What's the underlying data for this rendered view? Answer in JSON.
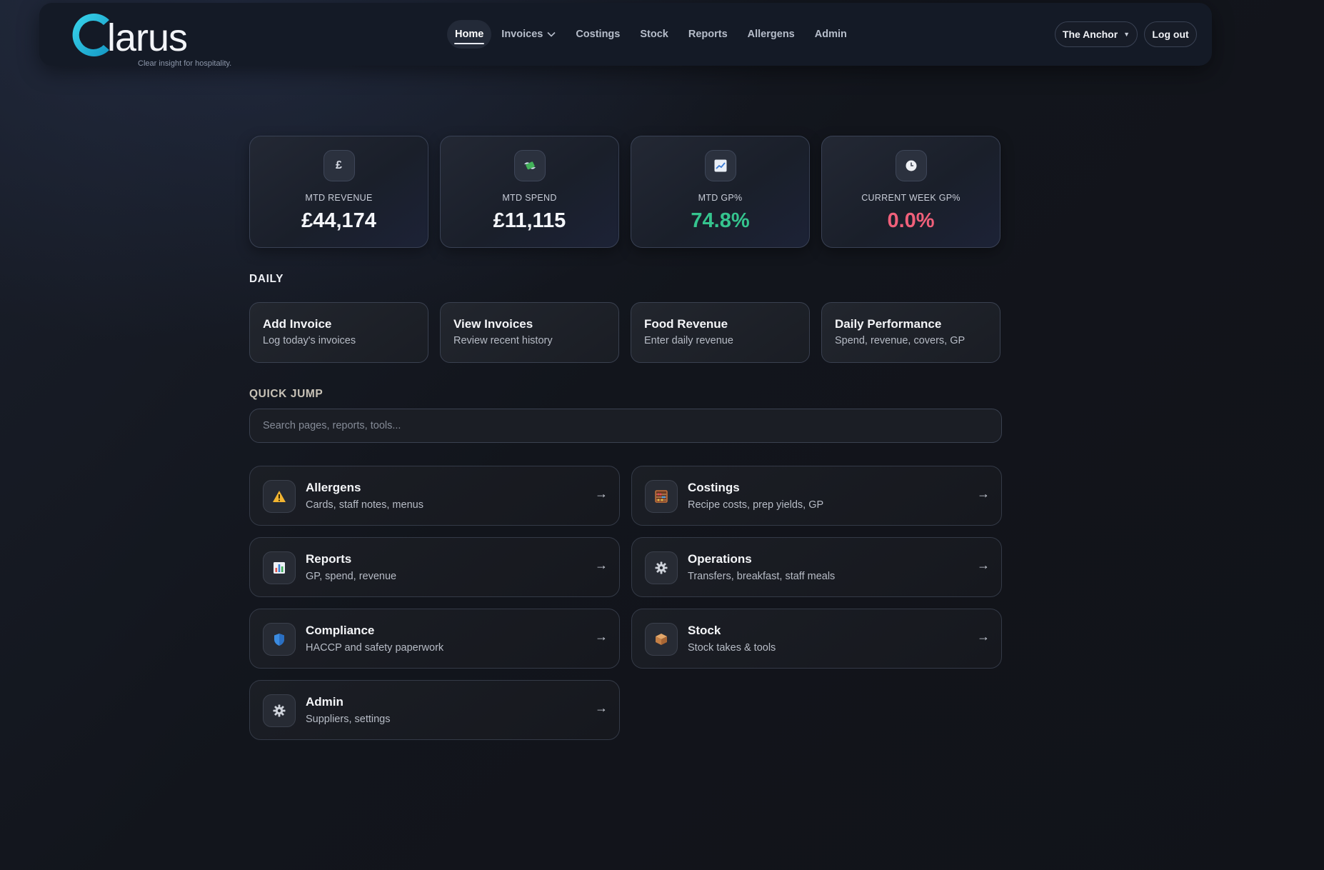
{
  "brand": {
    "name": "larus",
    "tagline": "Clear insight for hospitality.",
    "accent": "#1ec8e0"
  },
  "nav": {
    "items": [
      {
        "label": "Home",
        "active": true
      },
      {
        "label": "Invoices",
        "dropdown": true
      },
      {
        "label": "Costings"
      },
      {
        "label": "Stock"
      },
      {
        "label": "Reports"
      },
      {
        "label": "Allergens"
      },
      {
        "label": "Admin"
      }
    ],
    "venue": "The Anchor",
    "logout": "Log out"
  },
  "kpis": [
    {
      "icon": "pound-icon",
      "glyph": "£",
      "label": "MTD REVENUE",
      "value": "£44,174",
      "tone": "neutral"
    },
    {
      "icon": "money-wings-icon",
      "glyph": "",
      "label": "MTD SPEND",
      "value": "£11,115",
      "tone": "neutral"
    },
    {
      "icon": "chart-up-icon",
      "glyph": "",
      "label": "MTD GP%",
      "value": "74.8%",
      "tone": "good"
    },
    {
      "icon": "clock-icon",
      "glyph": "",
      "label": "CURRENT WEEK GP%",
      "value": "0.0%",
      "tone": "bad"
    }
  ],
  "colors": {
    "good": "#35c48e",
    "bad": "#f0607a"
  },
  "daily": {
    "title": "DAILY",
    "cards": [
      {
        "title": "Add Invoice",
        "sub": "Log today's invoices"
      },
      {
        "title": "View Invoices",
        "sub": "Review recent history"
      },
      {
        "title": "Food Revenue",
        "sub": "Enter daily revenue"
      },
      {
        "title": "Daily Performance",
        "sub": "Spend, revenue, covers, GP"
      }
    ]
  },
  "quick": {
    "title": "QUICK JUMP",
    "placeholder": "Search pages, reports, tools...",
    "cards": [
      {
        "icon": "warning-icon",
        "title": "Allergens",
        "sub": "Cards, staff notes, menus"
      },
      {
        "icon": "abacus-icon",
        "title": "Costings",
        "sub": "Recipe costs, prep yields, GP"
      },
      {
        "icon": "bar-chart-icon",
        "title": "Reports",
        "sub": "GP, spend, revenue"
      },
      {
        "icon": "gear-icon",
        "title": "Operations",
        "sub": "Transfers, breakfast, staff meals"
      },
      {
        "icon": "shield-icon",
        "title": "Compliance",
        "sub": "HACCP and safety paperwork"
      },
      {
        "icon": "box-icon",
        "title": "Stock",
        "sub": "Stock takes & tools"
      },
      {
        "icon": "gear-icon",
        "title": "Admin",
        "sub": "Suppliers, settings"
      }
    ],
    "arrow": "→"
  }
}
